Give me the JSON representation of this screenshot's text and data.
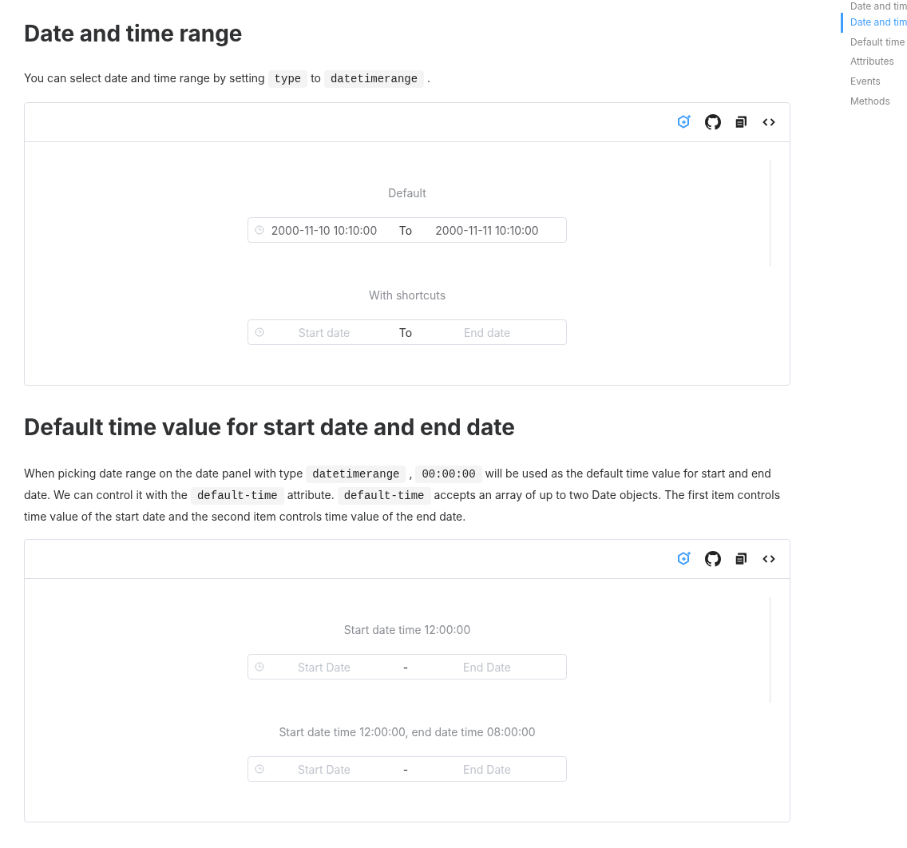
{
  "sections": [
    {
      "title": "Date and time range",
      "paragraph": [
        {
          "kind": "text",
          "text": "You can select date and time range by setting "
        },
        {
          "kind": "code",
          "text": "type"
        },
        {
          "kind": "text",
          "text": " to "
        },
        {
          "kind": "code",
          "text": "datetimerange"
        },
        {
          "kind": "text",
          "text": " ."
        }
      ],
      "demo": {
        "pickers": [
          {
            "label": "Default",
            "start": {
              "value": "2000-11-10 10:10:00"
            },
            "separator": "To",
            "end": {
              "value": "2000-11-11 10:10:00"
            }
          },
          {
            "label": "With shortcuts",
            "start": {
              "placeholder": "Start date"
            },
            "separator": "To",
            "end": {
              "placeholder": "End date"
            }
          }
        ]
      }
    },
    {
      "title": "Default time value for start date and end date",
      "paragraph": [
        {
          "kind": "text",
          "text": "When picking date range on the date panel with type "
        },
        {
          "kind": "code",
          "text": "datetimerange"
        },
        {
          "kind": "text",
          "text": " , "
        },
        {
          "kind": "code",
          "text": "00:00:00"
        },
        {
          "kind": "text",
          "text": " will be used as the default time value for start and end date. We can control it with the "
        },
        {
          "kind": "code",
          "text": "default-time"
        },
        {
          "kind": "text",
          "text": " attribute. "
        },
        {
          "kind": "code",
          "text": "default-time"
        },
        {
          "kind": "text",
          "text": " accepts an array of up to two Date objects. The first item controls time value of the start date and the second item controls time value of the end date."
        }
      ],
      "demo": {
        "pickers": [
          {
            "label": "Start date time 12:00:00",
            "start": {
              "placeholder": "Start Date"
            },
            "separator": "-",
            "end": {
              "placeholder": "End Date"
            }
          },
          {
            "label": "Start date time 12:00:00, end date time 08:00:00",
            "start": {
              "placeholder": "Start Date"
            },
            "separator": "-",
            "end": {
              "placeholder": "End Date"
            }
          }
        ]
      }
    }
  ],
  "toc": [
    {
      "label": "Date and tim",
      "selected": false
    },
    {
      "label": "Date and tim",
      "selected": true
    },
    {
      "label": "Default time",
      "selected": false
    },
    {
      "label": "Attributes",
      "selected": false
    },
    {
      "label": "Events",
      "selected": false
    },
    {
      "label": "Methods",
      "selected": false
    }
  ]
}
